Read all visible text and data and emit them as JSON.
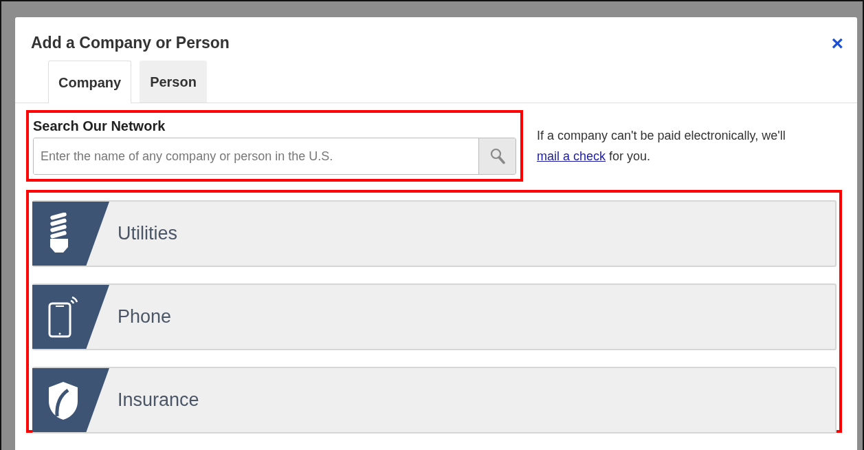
{
  "dialog": {
    "title": "Add a Company or Person",
    "close": "×"
  },
  "tabs": [
    {
      "label": "Company",
      "selected": true
    },
    {
      "label": "Person",
      "selected": false
    }
  ],
  "search": {
    "label": "Search Our Network",
    "placeholder": "Enter the name of any company or person in the U.S."
  },
  "note": {
    "before": "If a company can't be paid electronically, we'll",
    "link": "mail a check",
    "after": "for you."
  },
  "categories": [
    {
      "label": "Utilities",
      "kind": "bulb"
    },
    {
      "label": "Phone",
      "kind": "tablet"
    },
    {
      "label": "Insurance",
      "kind": "shield"
    }
  ]
}
